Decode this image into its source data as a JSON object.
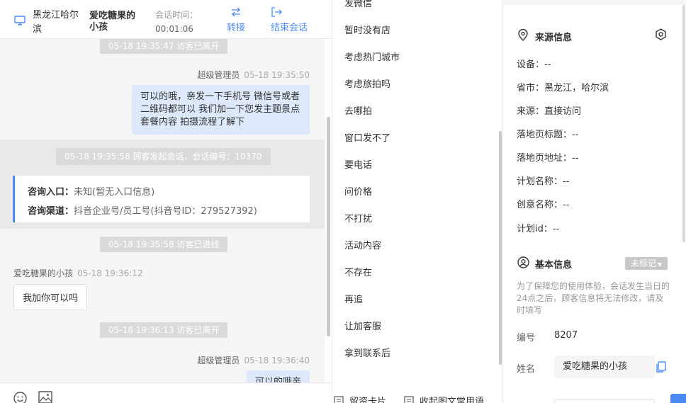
{
  "header": {
    "location": "黑龙江哈尔滨",
    "visitor_name": "爱吃糖果的小孩",
    "time_label": "会话时间：",
    "time_value": "00:01:06",
    "transfer_label": "转接",
    "end_label": "结束会话"
  },
  "chat": {
    "sys1": "05-18 19:35:47 访客已离开",
    "msg1_sender": "超级管理员",
    "msg1_time": "05-18 19:35:50",
    "msg1_line1": "可以的哦，亲发一下手机号 微信号或者",
    "msg1_line2": "二维码都可以 我们加一下您发主题景点",
    "msg1_line3": "套餐内容 拍摄流程了解下",
    "sys2": "05-18 19:35:58 顾客发起会话，会话编号：10370",
    "card_entry_label": "咨询入口：",
    "card_entry_value": "未知(暂无入口信息)",
    "card_channel_label": "咨询渠道：",
    "card_channel_value": "抖音企业号/员工号(抖音号ID：279527392)",
    "sys3": "05-18 19:35:58 访客已进线",
    "msg2_sender": "爱吃糖果的小孩",
    "msg2_time": "05-18 19:36:12",
    "msg2_text": "我加你可以吗",
    "sys4": "05-18 19:36:13 访客已离开",
    "msg3_sender": "超级管理员",
    "msg3_time": "05-18 19:36:40",
    "msg3_text": "可以的哦亲"
  },
  "quick_replies": {
    "items": [
      "发微信",
      "暂时没有店",
      "考虑热门城市",
      "考虑旅拍吗",
      "去哪拍",
      "窗口发不了",
      "要电话",
      "问价格",
      "不打扰",
      "活动内容",
      "不存在",
      "再追",
      "让加客服",
      "拿到联系后"
    ],
    "footer_card": "留资卡片",
    "footer_collapse": "收起图文常用语"
  },
  "info": {
    "source_title": "来源信息",
    "device": "设备：--",
    "province": "省市：黑龙江，哈尔滨",
    "source": "来源：直接访问",
    "landing_title": "落地页标题：--",
    "landing_url": "落地页地址：--",
    "plan_name": "计划名称：--",
    "creative_name": "创意名称：--",
    "plan_id": "计划id：--",
    "basic_title": "基本信息",
    "tag_btn": "未标记",
    "notice": "为了保障您的使用体验，会话发生当日的24点之后，顾客信息将无法修改，请及时填写",
    "id_label": "编号",
    "id_value": "8207",
    "name_label": "姓名",
    "name_value": "爱吃糖果的小孩"
  },
  "colors": {
    "accent": "#4a8af4",
    "bubble_out": "#dde9fb",
    "system_pill": "#dadada"
  }
}
